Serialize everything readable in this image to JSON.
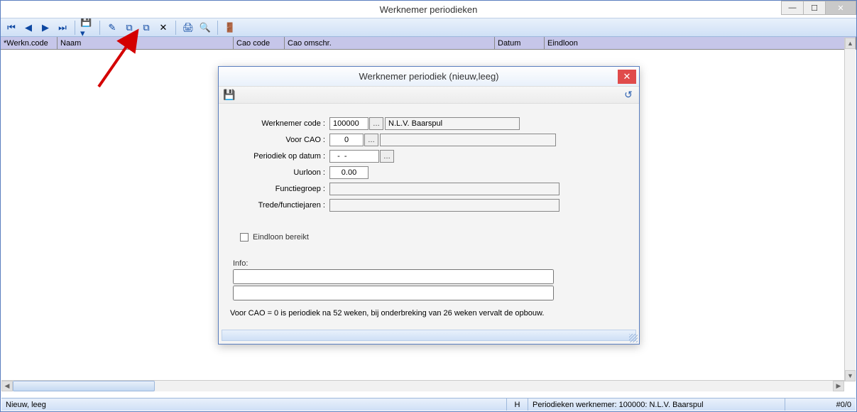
{
  "window": {
    "title": "Werknemer periodieken"
  },
  "columns": {
    "c0": "*Werkn.code",
    "c1": "Naam",
    "c2": "Cao code",
    "c3": "Cao omschr.",
    "c4": "Datum",
    "c5": "Eindloon"
  },
  "dialog": {
    "title": "Werknemer periodiek  (nieuw,leeg)",
    "labels": {
      "werknemer_code": "Werknemer code :",
      "voor_cao": "Voor CAO :",
      "periodiek_datum": "Periodiek op datum :",
      "uurloon": "Uurloon :",
      "functiegroep": "Functiegroep :",
      "trede": "Trede/functiejaren :",
      "eindloon_bereikt": "Eindloon bereikt",
      "info": "Info:"
    },
    "values": {
      "werknemer_code": "100000",
      "werknemer_naam": "N.L.V. Baarspul",
      "voor_cao": "0",
      "periodiek_datum": "  -  -",
      "uurloon": "0.00",
      "functiegroep": "",
      "trede": "",
      "info1": "",
      "info2": ""
    },
    "hint": "Voor CAO = 0 is periodiek na 52 weken, bij onderbreking van 26 weken vervalt de opbouw."
  },
  "status": {
    "left": "Nieuw, leeg",
    "h": "H",
    "info": "Periodieken werknemer: 100000: N.L.V. Baarspul",
    "count": "#0/0"
  }
}
